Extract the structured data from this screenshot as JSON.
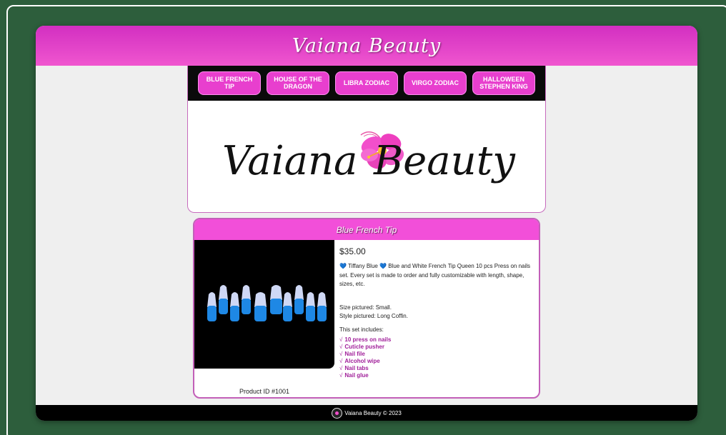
{
  "header": {
    "title": "Vaiana Beauty"
  },
  "nav": {
    "items": [
      {
        "label": "BLUE FRENCH TIP"
      },
      {
        "label": "HOUSE OF THE DRAGON"
      },
      {
        "label": "LIBRA ZODIAC"
      },
      {
        "label": "VIRGO ZODIAC"
      },
      {
        "label": "HALLOWEEN STEPHEN KING"
      }
    ]
  },
  "banner": {
    "logo_text_left": "Vaiana",
    "logo_text_right": "Beauty"
  },
  "product": {
    "title": "Blue French Tip",
    "price": "$35.00",
    "description_line1": "💙 Tiffany Blue 💙 Blue and White French Tip Queen 10 pcs Press on nails set. Every set is made to order and fully customizable with length, shape, sizes, etc.",
    "size": "Size pictured: Small.",
    "style": "Style pictured: Long Coffin.",
    "includes_heading": "This set includes:",
    "includes": [
      "10 press on nails",
      "Cuticle pusher",
      "Nail file",
      "Alcohol wipe",
      "Nail tabs",
      "Nail glue"
    ],
    "check_symbol": "√",
    "product_id": "Product ID #1001"
  },
  "footer": {
    "text": "Vaiana Beauty © 2023"
  },
  "colors": {
    "background": "#2d5e3c",
    "header_gradient_top": "#d22fc1",
    "header_gradient_bottom": "#f056cf",
    "nav_button": "#e83fce",
    "product_title_bar": "#f24fd9",
    "includes_text": "#a1209a",
    "nail_blue": "#1e88e5"
  }
}
